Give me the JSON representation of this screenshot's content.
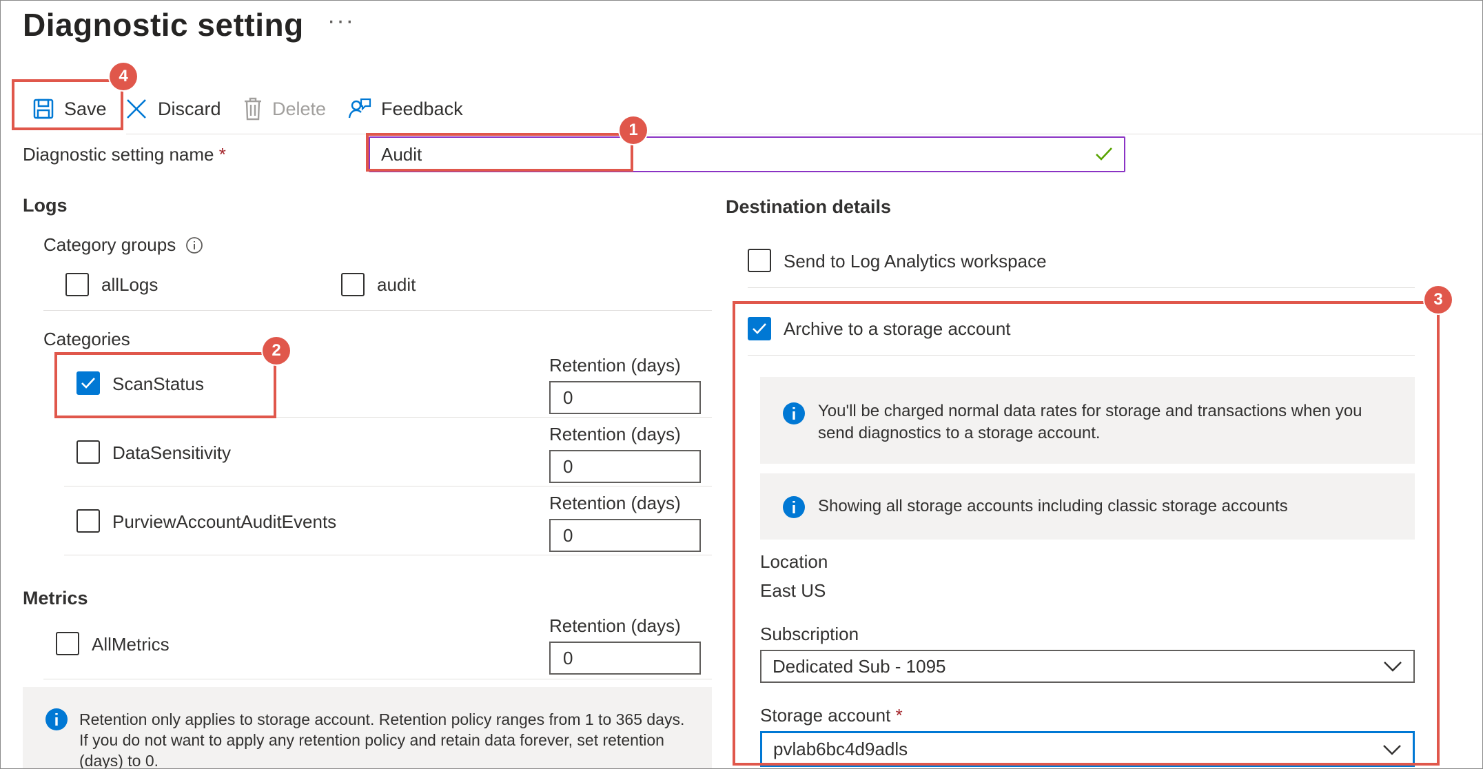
{
  "header": {
    "title": "Diagnostic setting",
    "more": "···"
  },
  "toolbar": {
    "save": "Save",
    "discard": "Discard",
    "delete": "Delete",
    "feedback": "Feedback"
  },
  "name_field": {
    "label": "Diagnostic setting name",
    "required": "*",
    "value": "Audit"
  },
  "logs": {
    "heading": "Logs",
    "category_groups_label": "Category groups",
    "groups": [
      {
        "label": "allLogs",
        "checked": false
      },
      {
        "label": "audit",
        "checked": false
      }
    ],
    "categories_label": "Categories",
    "categories": [
      {
        "label": "ScanStatus",
        "checked": true,
        "retention_label": "Retention (days)",
        "retention": "0"
      },
      {
        "label": "DataSensitivity",
        "checked": false,
        "retention_label": "Retention (days)",
        "retention": "0"
      },
      {
        "label": "PurviewAccountAuditEvents",
        "checked": false,
        "retention_label": "Retention (days)",
        "retention": "0"
      }
    ]
  },
  "metrics": {
    "heading": "Metrics",
    "items": [
      {
        "label": "AllMetrics",
        "checked": false,
        "retention_label": "Retention (days)",
        "retention": "0"
      }
    ]
  },
  "retention_info": "Retention only applies to storage account. Retention policy ranges from 1 to 365 days. If you do not want to apply any retention policy and retain data forever, set retention (days) to 0.",
  "destination": {
    "heading": "Destination details",
    "log_analytics": {
      "label": "Send to Log Analytics workspace",
      "checked": false
    },
    "archive": {
      "label": "Archive to a storage account",
      "checked": true
    },
    "info1": "You'll be charged normal data rates for storage and transactions when you send diagnostics to a storage account.",
    "info2": "Showing all storage accounts including classic storage accounts",
    "location_label": "Location",
    "location_value": "East US",
    "subscription_label": "Subscription",
    "subscription_value": "Dedicated Sub - 1095",
    "storage_label": "Storage account",
    "storage_required": "*",
    "storage_value": "pvlab6bc4d9adls"
  },
  "badges": {
    "b1": "1",
    "b2": "2",
    "b3": "3",
    "b4": "4"
  },
  "colors": {
    "accent": "#0078d4",
    "highlight": "#e0574b",
    "focus": "#8a33c4",
    "valid": "#57a300"
  },
  "icons": [
    "save-icon",
    "close-icon",
    "trash-icon",
    "feedback-icon",
    "info-icon",
    "check-icon",
    "chevron-down-icon"
  ]
}
